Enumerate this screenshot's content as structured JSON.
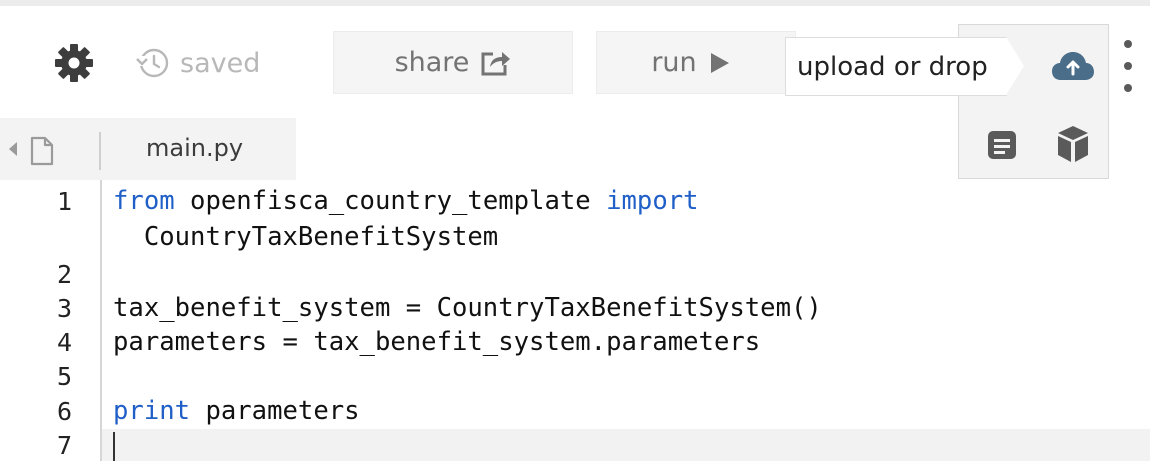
{
  "toolbar": {
    "saved_label": "saved",
    "share_label": "share",
    "run_label": "run",
    "upload_tooltip": "upload or drop"
  },
  "icons": {
    "settings": "gear-icon",
    "saved": "history-icon",
    "share": "share-icon",
    "run": "play-icon",
    "upload": "cloud-upload-icon",
    "document": "document-icon",
    "package": "cube-icon",
    "more": "kebab-icon",
    "file": "file-icon",
    "collapse": "chevron-left-icon"
  },
  "colors": {
    "keyword": "#1f5fc7",
    "cloud": "#4a6d8a",
    "button_bg": "#f5f5f5"
  },
  "editor": {
    "file_tab": "main.py",
    "lines": [
      {
        "num": "1",
        "parts": [
          {
            "t": "from",
            "kw": true
          },
          {
            "t": " openfisca_country_template "
          },
          {
            "t": "import",
            "kw": true
          }
        ]
      },
      {
        "num": "",
        "parts": [
          {
            "t": "  CountryTaxBenefitSystem"
          }
        ]
      },
      {
        "num": "2",
        "parts": []
      },
      {
        "num": "3",
        "parts": [
          {
            "t": "tax_benefit_system = CountryTaxBenefitSystem()"
          }
        ]
      },
      {
        "num": "4",
        "parts": [
          {
            "t": "parameters = tax_benefit_system.parameters"
          }
        ]
      },
      {
        "num": "5",
        "parts": []
      },
      {
        "num": "6",
        "parts": [
          {
            "t": "print",
            "kw": true
          },
          {
            "t": " parameters"
          }
        ]
      },
      {
        "num": "7",
        "parts": []
      }
    ]
  }
}
